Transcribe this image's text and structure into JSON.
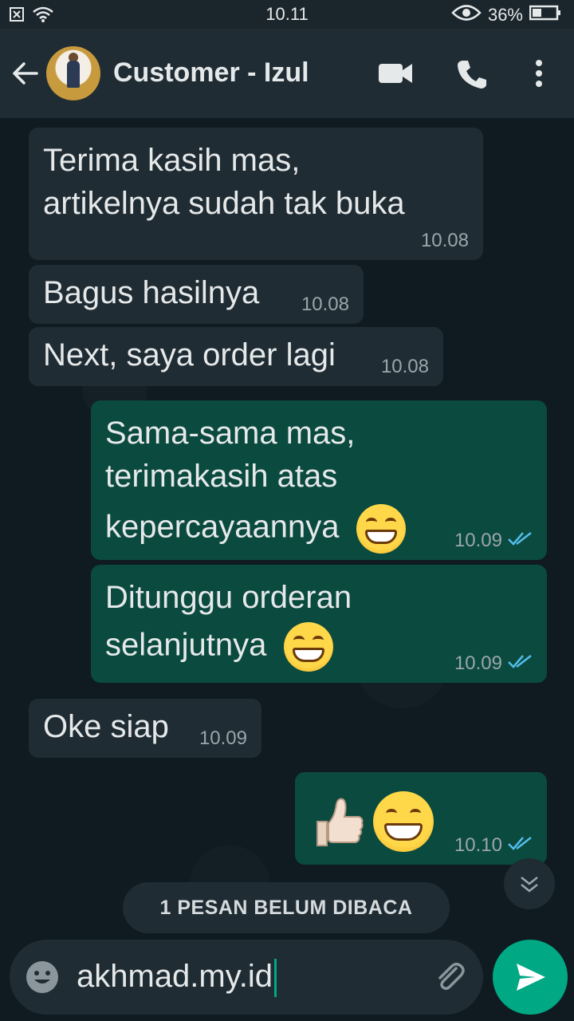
{
  "status_bar": {
    "time": "10.11",
    "battery": "36%"
  },
  "header": {
    "contact_name": "Customer - Izul"
  },
  "messages": [
    {
      "dir": "in",
      "lines": [
        "Terima kasih mas,",
        "artikelnya sudah tak buka"
      ],
      "time": "10.08"
    },
    {
      "dir": "in",
      "lines": [
        "Bagus hasilnya"
      ],
      "time": "10.08"
    },
    {
      "dir": "in",
      "lines": [
        "Next, saya order lagi"
      ],
      "time": "10.08"
    },
    {
      "dir": "out",
      "lines": [
        "Sama-sama mas,",
        "terimakasih atas",
        "kepercayaannya"
      ],
      "time": "10.09",
      "emoji": "grinning-face"
    },
    {
      "dir": "out",
      "lines": [
        "Ditunggu orderan",
        "selanjutnya"
      ],
      "time": "10.09",
      "emoji": "grinning-face"
    },
    {
      "dir": "in",
      "lines": [
        "Oke siap"
      ],
      "time": "10.09"
    },
    {
      "dir": "out",
      "lines": [],
      "time": "10.10",
      "emoji": "thumbs-up + grinning-face"
    }
  ],
  "unread_banner": "1 PESAN BELUM DIBACA",
  "composer": {
    "text": "akhmad.my.id"
  },
  "colors": {
    "incoming": "#1f2c33",
    "outgoing": "#0b4a3f",
    "accent": "#00a884",
    "read_ticks": "#53bdeb"
  }
}
